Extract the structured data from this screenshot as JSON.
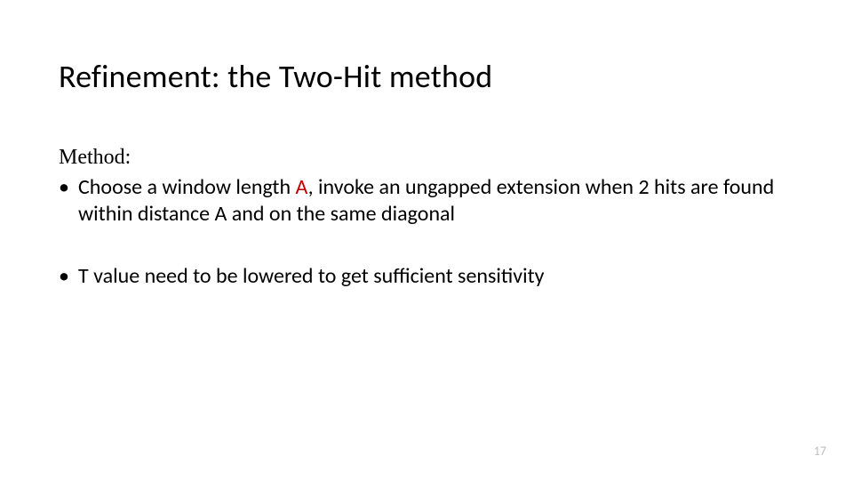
{
  "slide": {
    "title": "Refinement: the Two-Hit method",
    "method_label": "Method:",
    "bullet1": {
      "prefix": "Choose a window length ",
      "hl": "A",
      "suffix": ", invoke an ungapped extension when 2 hits are found within distance A and on the same diagonal"
    },
    "bullet2": "T value need to be lowered to get sufficient sensitivity",
    "page_number": "17"
  }
}
